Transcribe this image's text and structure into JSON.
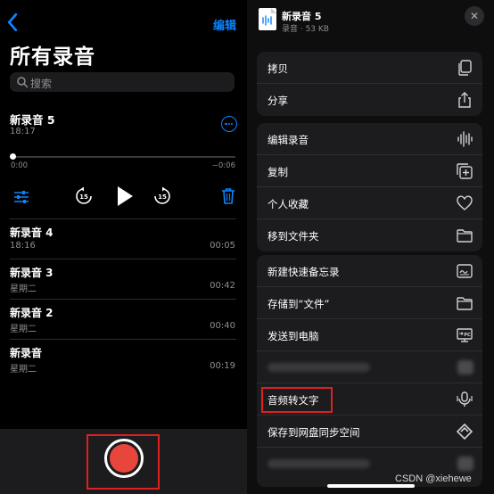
{
  "left": {
    "back_icon": "chevron-left-icon",
    "edit_label": "编辑",
    "title": "所有录音",
    "search_placeholder": "搜索",
    "expanded": {
      "name": "新录音 5",
      "date": "18:17",
      "time_start": "0:00",
      "time_end": "−0:06",
      "playback_progress": 0,
      "controls": [
        "sliders-icon",
        "skip-back-15-icon",
        "play-icon",
        "skip-forward-15-icon",
        "trash-icon"
      ]
    },
    "recordings": [
      {
        "name": "新录音 4",
        "date": "18:16",
        "duration": "00:05"
      },
      {
        "name": "新录音 3",
        "date": "星期二",
        "duration": "00:42"
      },
      {
        "name": "新录音 2",
        "date": "星期二",
        "duration": "00:40"
      },
      {
        "name": "新录音",
        "date": "星期二",
        "duration": "00:19"
      }
    ]
  },
  "sheet": {
    "file_name": "新录音 5",
    "file_meta": "录音 · 53 KB",
    "close_icon": "close-icon",
    "groups": [
      [
        {
          "label": "拷贝",
          "icon": "copy-icon"
        },
        {
          "label": "分享",
          "icon": "share-icon"
        }
      ],
      [
        {
          "label": "编辑录音",
          "icon": "waveform-icon"
        },
        {
          "label": "复制",
          "icon": "duplicate-icon"
        },
        {
          "label": "个人收藏",
          "icon": "heart-icon"
        },
        {
          "label": "移到文件夹",
          "icon": "folder-icon"
        }
      ],
      [
        {
          "label": "新建快速备忘录",
          "icon": "quick-note-icon"
        },
        {
          "label": "存储到“文件”",
          "icon": "folder-icon"
        },
        {
          "label": "发送到电脑",
          "icon": "send-to-pc-icon"
        },
        {
          "label": "",
          "icon": "blurred-icon"
        },
        {
          "label": "音频转文字",
          "icon": "microphone-icon"
        },
        {
          "label": "保存到网盘同步空间",
          "icon": "cloud-sync-icon"
        },
        {
          "label": "",
          "icon": "blurred-icon"
        }
      ]
    ]
  },
  "watermark": "CSDN @xiehewe",
  "colors": {
    "accent": "#0a84ff",
    "record": "#e8453c",
    "highlight": "#e02020"
  }
}
